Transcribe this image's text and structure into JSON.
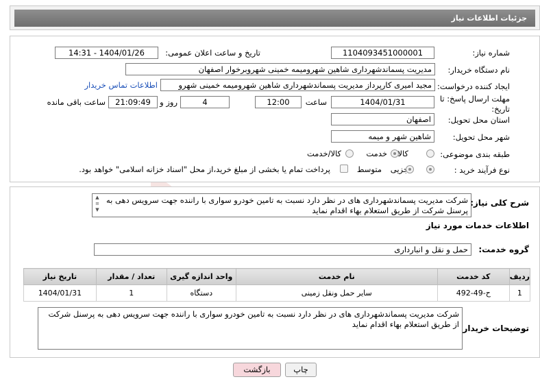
{
  "header": {
    "title": "جزئیات اطلاعات نیاز"
  },
  "form": {
    "need_number_label": "شماره نیاز:",
    "need_number": "1104093451000001",
    "announce_label": "تاریخ و ساعت اعلان عمومی:",
    "announce_value": "1404/01/26 - 14:31",
    "buyer_org_label": "نام دستگاه خریدار:",
    "buyer_org": "مدیریت پسماندشهرداری شاهین شهرومیمه خمینی شهروبرخوار اصفهان",
    "creator_label": "ایجاد کننده درخواست:",
    "creator": "مجید امیری کارپرداز مدیریت پسماندشهرداری شاهین شهرومیمه خمینی شهرو",
    "contact_link": "اطلاعات تماس خریدار",
    "deadline_label": "مهلت ارسال پاسخ: تا تاریخ:",
    "deadline_date": "1404/01/31",
    "time_label": "ساعت",
    "deadline_time": "12:00",
    "days_value": "4",
    "days_label": "روز و",
    "remaining_time": "21:09:49",
    "remaining_label": "ساعت باقی مانده",
    "province_label": "استان محل تحویل:",
    "province": "اصفهان",
    "city_label": "شهر محل تحویل:",
    "city": "شاهین شهر و میمه",
    "category_label": "طبقه بندی موضوعی:",
    "category_options": [
      "کالا",
      "خدمت",
      "کالا/خدمت"
    ],
    "category_selected": "خدمت",
    "process_label": "نوع فرآیند خرید :",
    "process_options": [
      "جزیی",
      "متوسط"
    ],
    "process_selected": "جزیی",
    "payment_note": "پرداخت تمام یا بخشی از مبلغ خرید،از محل \"اسناد خزانه اسلامی\" خواهد بود."
  },
  "details": {
    "summary_label": "شرح کلی نیاز:",
    "summary_text": "شرکت مدیریت پسماندشهرداری های در نظر دارد نسبت به تامین خودرو سواری با راننده جهت سرویس دهی به پرسنل شرکت از طریق استعلام بهاء اقدام نماید",
    "services_title": "اطلاعات خدمات مورد نیاز",
    "service_group_label": "گروه خدمت:",
    "service_group": "حمل و نقل و انبارداری",
    "table": {
      "headers": [
        "ردیف",
        "کد خدمت",
        "نام خدمت",
        "واحد اندازه گیری",
        "تعداد / مقدار",
        "تاریخ نیاز"
      ],
      "rows": [
        [
          "1",
          "ح-49-492",
          "سایر حمل ونقل زمینی",
          "دستگاه",
          "1",
          "1404/01/31"
        ]
      ]
    },
    "buyer_notes_label": "توضیحات خریدار:",
    "buyer_notes": "شرکت مدیریت پسماندشهرداری های در نظر دارد نسبت به تامین خودرو سواری با راننده جهت سرویس دهی به پرسنل شرکت از طریق استعلام بهاء اقدام نماید"
  },
  "buttons": {
    "print": "چاپ",
    "back": "بازگشت"
  },
  "watermark": {
    "text": "AriaTender.neT"
  },
  "colors": {
    "header_bg": "#7f7f7f",
    "link": "#1a4fb8",
    "back_button": "#f7d7dc",
    "watermark": "#c0392b"
  }
}
